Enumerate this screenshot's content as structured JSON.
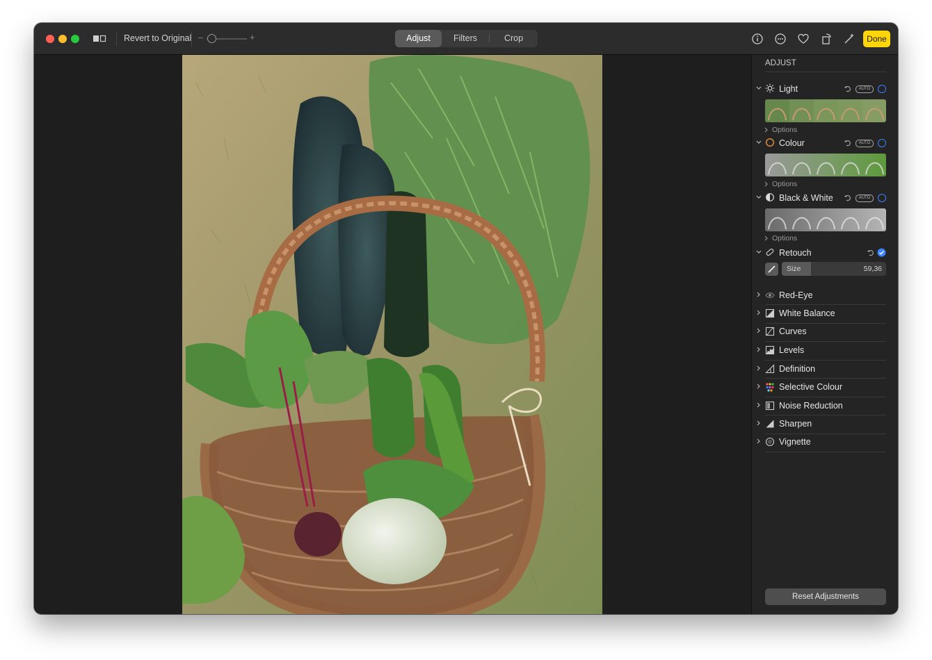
{
  "toolbar": {
    "revert_label": "Revert to Original",
    "zoom_minus": "–",
    "zoom_plus": "+",
    "tabs": [
      {
        "label": "Adjust",
        "active": true
      },
      {
        "label": "Filters",
        "active": false
      },
      {
        "label": "Crop",
        "active": false
      }
    ],
    "done_label": "Done",
    "icons": [
      "info-icon",
      "more-icon",
      "favorite-icon",
      "rotate-icon",
      "auto-enhance-icon"
    ]
  },
  "photo": {
    "subject": "wicker basket of garden vegetables on grass"
  },
  "sidebar": {
    "heading": "ADJUST",
    "sections": [
      {
        "label": "Light",
        "icon": "sun-icon",
        "options": "Options"
      },
      {
        "label": "Colour",
        "icon": "colour-circle-icon",
        "options": "Options"
      },
      {
        "label": "Black & White",
        "icon": "half-circle-icon",
        "options": "Options"
      },
      {
        "label": "Retouch",
        "icon": "bandage-icon"
      }
    ],
    "auto_badge": "AUTO",
    "retouch": {
      "size_label": "Size",
      "size_value": "59,36"
    },
    "items": [
      {
        "label": "Red-Eye",
        "icon": "eye-icon"
      },
      {
        "label": "White Balance",
        "icon": "white-balance-icon"
      },
      {
        "label": "Curves",
        "icon": "curves-icon"
      },
      {
        "label": "Levels",
        "icon": "levels-icon"
      },
      {
        "label": "Definition",
        "icon": "definition-icon"
      },
      {
        "label": "Selective Colour",
        "icon": "selective-colour-icon"
      },
      {
        "label": "Noise Reduction",
        "icon": "noise-reduction-icon"
      },
      {
        "label": "Sharpen",
        "icon": "sharpen-icon"
      },
      {
        "label": "Vignette",
        "icon": "vignette-icon"
      }
    ],
    "reset_label": "Reset Adjustments"
  },
  "colors": {
    "accent_done": "#ffd60a",
    "accent_blue": "#3a84ff"
  }
}
